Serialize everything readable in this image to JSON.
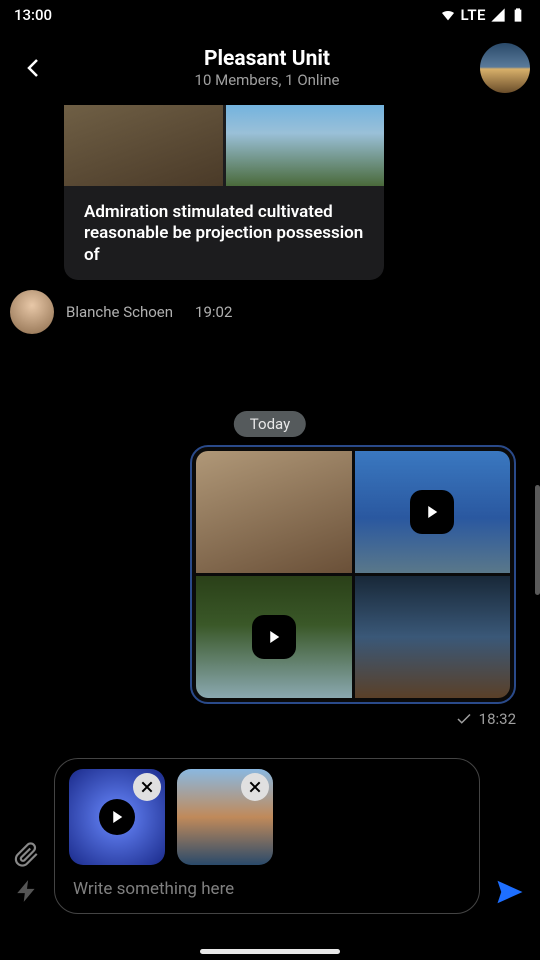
{
  "status": {
    "time": "13:00",
    "network": "LTE"
  },
  "header": {
    "title": "Pleasant Unit",
    "subtitle": "10 Members, 1 Online"
  },
  "messages": {
    "incoming": {
      "caption": "Admiration stimulated cultivated reasonable be projection possession of",
      "sender": "Blanche Schoen",
      "time": "19:02"
    },
    "date_separator": "Today",
    "outgoing": {
      "time": "18:32"
    }
  },
  "composer": {
    "placeholder": "Write something here"
  }
}
